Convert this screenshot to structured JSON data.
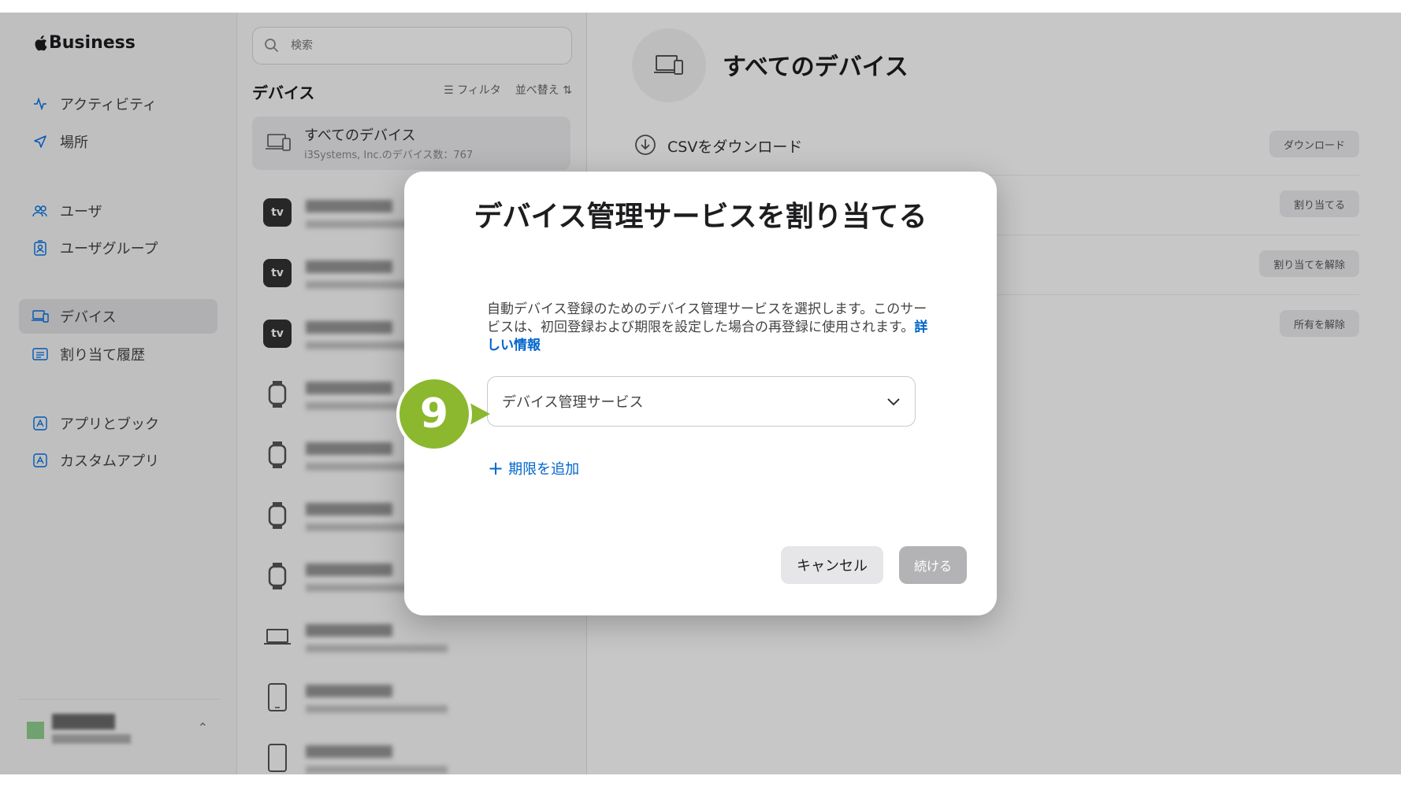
{
  "sidebar": {
    "logo": "Business",
    "items": [
      {
        "label": "アクティビティ",
        "icon": "activity-icon"
      },
      {
        "label": "場所",
        "icon": "location-icon"
      },
      {
        "label": "ユーザ",
        "icon": "users-icon"
      },
      {
        "label": "ユーザグループ",
        "icon": "user-group-icon"
      },
      {
        "label": "デバイス",
        "icon": "devices-icon",
        "active": true
      },
      {
        "label": "割り当て履歴",
        "icon": "history-icon"
      },
      {
        "label": "アプリとブック",
        "icon": "apps-icon"
      },
      {
        "label": "カスタムアプリ",
        "icon": "custom-apps-icon"
      }
    ]
  },
  "list": {
    "search_placeholder": "検索",
    "title": "デバイス",
    "filter_label": "フィルタ",
    "sort_label": "並べ替え",
    "all_devices": {
      "title": "すべてのデバイス",
      "subtitle": "i3Systems, Inc.のデバイス数：767"
    },
    "devices": [
      {
        "type": "tv",
        "tv_label": "tv"
      },
      {
        "type": "tv",
        "tv_label": "tv"
      },
      {
        "type": "tv",
        "tv_label": "tv"
      },
      {
        "type": "watch"
      },
      {
        "type": "watch"
      },
      {
        "type": "watch"
      },
      {
        "type": "watch"
      },
      {
        "type": "laptop"
      },
      {
        "type": "tablet"
      },
      {
        "type": "tablet"
      }
    ]
  },
  "main": {
    "title": "すべてのデバイス",
    "csv_label": "CSVをダウンロード",
    "actions": [
      {
        "button": "ダウンロード"
      },
      {
        "button": "割り当てる"
      },
      {
        "button": "割り当てを解除"
      },
      {
        "button": "所有を解除"
      }
    ]
  },
  "modal": {
    "title": "デバイス管理サービスを割り当てる",
    "description": "自動デバイス登録のためのデバイス管理サービスを選択します。このサービスは、初回登録および期限を設定した場合の再登録に使用されます。",
    "learn_more": "詳しい情報",
    "select_value": "デバイス管理サービス",
    "add_limit": "期限を追加",
    "cancel": "キャンセル",
    "continue": "続ける"
  },
  "callout": {
    "number": "9",
    "color": "#8bb82e"
  },
  "colors": {
    "accent": "#0066cc",
    "overlay": "rgba(0,0,0,0.22)"
  }
}
